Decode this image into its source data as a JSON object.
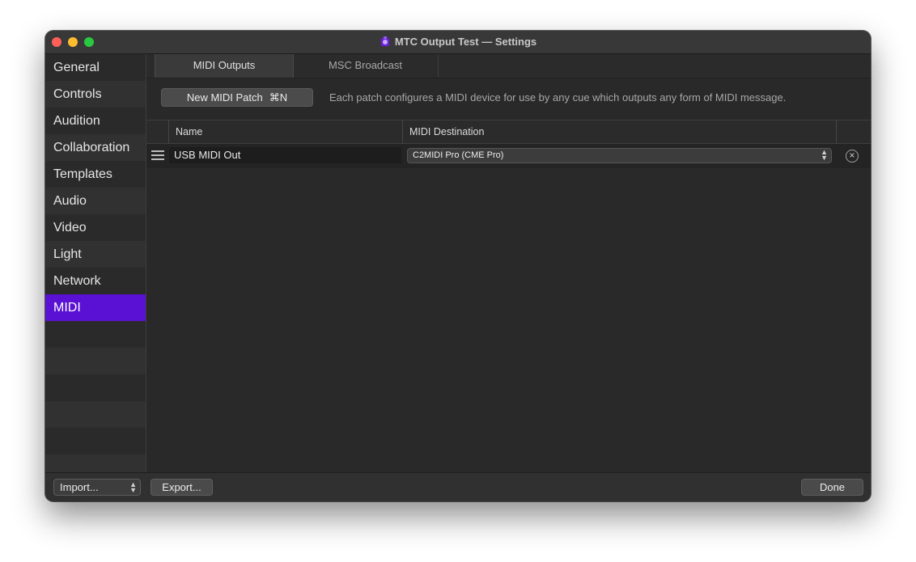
{
  "window": {
    "title": "MTC Output Test — Settings",
    "app_icon": "app-icon"
  },
  "sidebar": {
    "items": [
      {
        "label": "General"
      },
      {
        "label": "Controls"
      },
      {
        "label": "Audition"
      },
      {
        "label": "Collaboration"
      },
      {
        "label": "Templates"
      },
      {
        "label": "Audio"
      },
      {
        "label": "Video"
      },
      {
        "label": "Light"
      },
      {
        "label": "Network"
      },
      {
        "label": "MIDI",
        "selected": true
      }
    ],
    "accent_color": "#5a11d4"
  },
  "tabs": [
    {
      "label": "MIDI Outputs",
      "active": true
    },
    {
      "label": "MSC Broadcast",
      "active": false
    }
  ],
  "toolbar": {
    "new_patch_label": "New MIDI Patch",
    "new_patch_shortcut": "⌘N",
    "description": "Each patch configures a MIDI device for use by any cue which outputs any form of MIDI message."
  },
  "table": {
    "columns": [
      "Name",
      "MIDI Destination"
    ],
    "rows": [
      {
        "name": "USB MIDI Out",
        "destination": "C2MIDI Pro (CME Pro)"
      }
    ]
  },
  "footer": {
    "import_label": "Import...",
    "export_label": "Export...",
    "done_label": "Done"
  }
}
